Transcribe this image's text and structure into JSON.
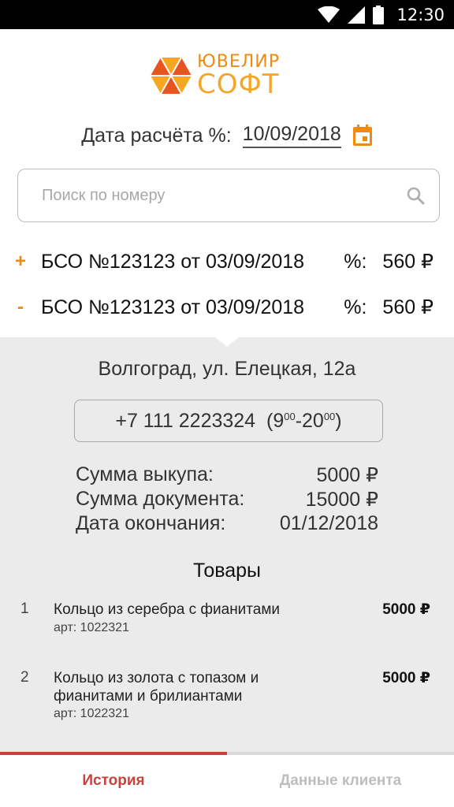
{
  "status_bar": {
    "time": "12:30"
  },
  "logo": {
    "line1": "ЮВЕЛИР",
    "line2": "СОФТ"
  },
  "date": {
    "label": "Дата расчёта %:",
    "value": "10/09/2018"
  },
  "search": {
    "placeholder": "Поиск по номеру"
  },
  "documents": [
    {
      "sign": "+",
      "title": "БСО №123123 от 03/09/2018",
      "pct_label": "%:",
      "amount": "560 ₽"
    },
    {
      "sign": "-",
      "title": "БСО №123123 от 03/09/2018",
      "pct_label": "%:",
      "amount": "560 ₽"
    }
  ],
  "details": {
    "address": "Волгоград, ул. Елецкая, 12а",
    "phone": "+7 111 2223324",
    "hours_open": "9",
    "hours_open_min": "00",
    "hours_sep": " - ",
    "hours_close": "20",
    "hours_close_min": "00",
    "rows": [
      {
        "label": "Сумма выкупа:",
        "value": "5000 ₽"
      },
      {
        "label": "Сумма документа:",
        "value": "15000 ₽"
      },
      {
        "label": "Дата окончания:",
        "value": "01/12/2018"
      }
    ]
  },
  "goods": {
    "title": "Товары",
    "items": [
      {
        "num": "1",
        "name": "Кольцо из серебра с фианитами",
        "article": "арт: 1022321",
        "price": "5000 ₽"
      },
      {
        "num": "2",
        "name": "Кольцо из золота с топазом и фианитами и брилиантами",
        "article": "арт: 1022321",
        "price": "5000 ₽"
      }
    ]
  },
  "tabs": [
    {
      "label": "История",
      "active": true
    },
    {
      "label": "Данные клиента",
      "active": false
    }
  ],
  "colors": {
    "accent": "#f08a12",
    "active_tab": "#c7413d",
    "panel_bg": "#ebebeb"
  },
  "icons": {
    "calendar": "calendar-icon",
    "search": "search-icon",
    "wifi": "wifi-icon",
    "signal": "signal-icon",
    "battery": "battery-icon"
  }
}
